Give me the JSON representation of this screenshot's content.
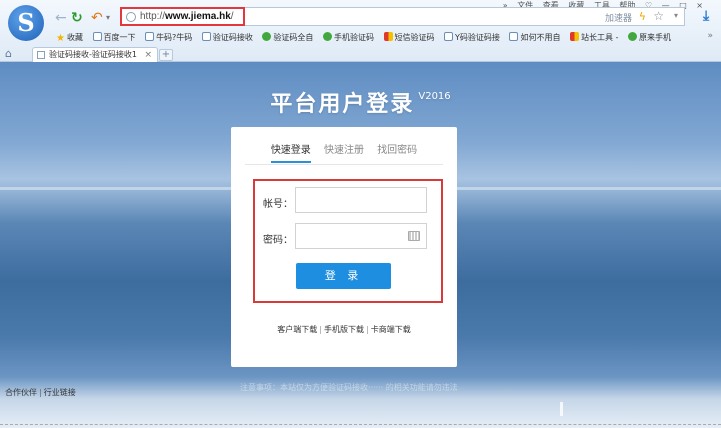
{
  "browser": {
    "logo_glyph": "S",
    "menu": [
      "»",
      "文件",
      "查看",
      "收藏",
      "工具",
      "帮助",
      "♡",
      "—",
      "□",
      "×"
    ],
    "url_prefix": "http://",
    "url_domain": "www.jiema.hk",
    "url_suffix": "/",
    "accelerator": "加速器",
    "bookmarks_more": "»",
    "bookmarks": [
      {
        "label": "收藏",
        "icon": "star"
      },
      {
        "label": "百度一下",
        "icon": "doc"
      },
      {
        "label": "牛码?牛码",
        "icon": "doc"
      },
      {
        "label": "验证码接收",
        "icon": "doc"
      },
      {
        "label": "验证码全自",
        "icon": "green"
      },
      {
        "label": "手机验证码",
        "icon": "green"
      },
      {
        "label": "短信验证码",
        "icon": "mix"
      },
      {
        "label": "Y码验证码接",
        "icon": "doc"
      },
      {
        "label": "如何不用自",
        "icon": "doc"
      },
      {
        "label": "站长工具 -",
        "icon": "mix"
      },
      {
        "label": "原来手机",
        "icon": "green"
      }
    ],
    "tab_title": "验证码接收-验证码接收1",
    "tab_close": "×",
    "new_tab": "+"
  },
  "page": {
    "title": "平台用户登录",
    "version": "V2016",
    "tabs": [
      "快速登录",
      "快速注册",
      "找回密码"
    ],
    "active_tab": 0,
    "account_label": "帐号：",
    "password_label": "密码：",
    "account_value": "",
    "password_value": "",
    "login_button": "登 录",
    "downloads": [
      "客户端下载",
      "手机版下载",
      "卡商端下载"
    ],
    "footer_links": [
      "合作伙伴",
      "行业链接"
    ],
    "footer_faint": "注意事项：本站仅为方便验证码接收······ 的相关功能请勿违法"
  },
  "colors": {
    "accent": "#1e8fe0",
    "highlight_border": "#d83a3a"
  }
}
